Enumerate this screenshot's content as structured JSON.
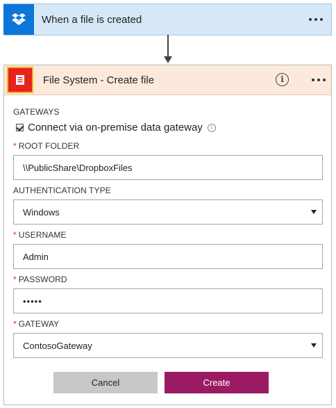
{
  "trigger": {
    "title": "When a file is created",
    "icon": "dropbox-icon",
    "accent": "#0c76d9"
  },
  "action": {
    "title": "File System - Create file",
    "icon": "file-system-icon",
    "header_color": "#fde9dc"
  },
  "form": {
    "gateways_label": "GATEWAYS",
    "connect_label": "Connect via on-premise data gateway",
    "connect_checked": true,
    "root_folder_label": "ROOT FOLDER",
    "root_folder_value": "\\\\PublicShare\\DropboxFiles",
    "auth_type_label": "AUTHENTICATION TYPE",
    "auth_type_value": "Windows",
    "username_label": "USERNAME",
    "username_value": "Admin",
    "password_label": "PASSWORD",
    "password_value": "•••••",
    "gateway_label": "GATEWAY",
    "gateway_value": "ContosoGateway",
    "required_marker": "*"
  },
  "buttons": {
    "cancel": "Cancel",
    "create": "Create",
    "create_color": "#9b1b63"
  }
}
